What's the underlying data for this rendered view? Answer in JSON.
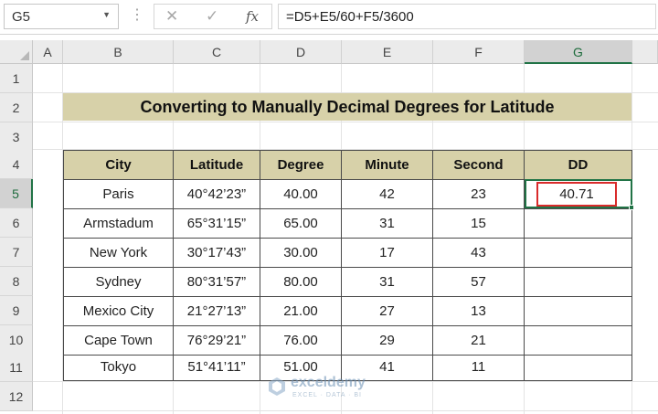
{
  "formula_bar": {
    "name_box": "G5",
    "formula": "=D5+E5/60+F5/3600",
    "cancel_icon": "✕",
    "enter_icon": "✓",
    "fx_label": "fx",
    "dots": "⋮",
    "dropdown_icon": "▼"
  },
  "columns": [
    "A",
    "B",
    "C",
    "D",
    "E",
    "F",
    "G"
  ],
  "rows": [
    "1",
    "2",
    "3",
    "4",
    "5",
    "6",
    "7",
    "8",
    "9",
    "10",
    "11",
    "12"
  ],
  "selected_column": "G",
  "selected_row": "5",
  "title": "Converting to Manually Decimal Degrees for Latitude",
  "table": {
    "headers": [
      "City",
      "Latitude",
      "Degree",
      "Minute",
      "Second",
      "DD"
    ],
    "rows": [
      [
        "Paris",
        "40°42’23”",
        "40.00",
        "42",
        "23",
        "40.71"
      ],
      [
        "Armstadum",
        "65°31’15”",
        "65.00",
        "31",
        "15",
        ""
      ],
      [
        "New York",
        "30°17’43”",
        "30.00",
        "17",
        "43",
        ""
      ],
      [
        "Sydney",
        "80°31’57”",
        "80.00",
        "31",
        "57",
        ""
      ],
      [
        "Mexico City",
        "21°27’13”",
        "21.00",
        "27",
        "13",
        ""
      ],
      [
        "Cape Town",
        "76°29’21”",
        "76.00",
        "29",
        "21",
        ""
      ],
      [
        "Tokyo",
        "51°41’11”",
        "51.00",
        "41",
        "11",
        ""
      ]
    ]
  },
  "watermark": {
    "name": "exceldemy",
    "tagline": "EXCEL · DATA · BI"
  },
  "colors": {
    "header_fill": "#d7d1a9",
    "selection_green": "#217346",
    "highlight_red": "#d92b2b"
  }
}
